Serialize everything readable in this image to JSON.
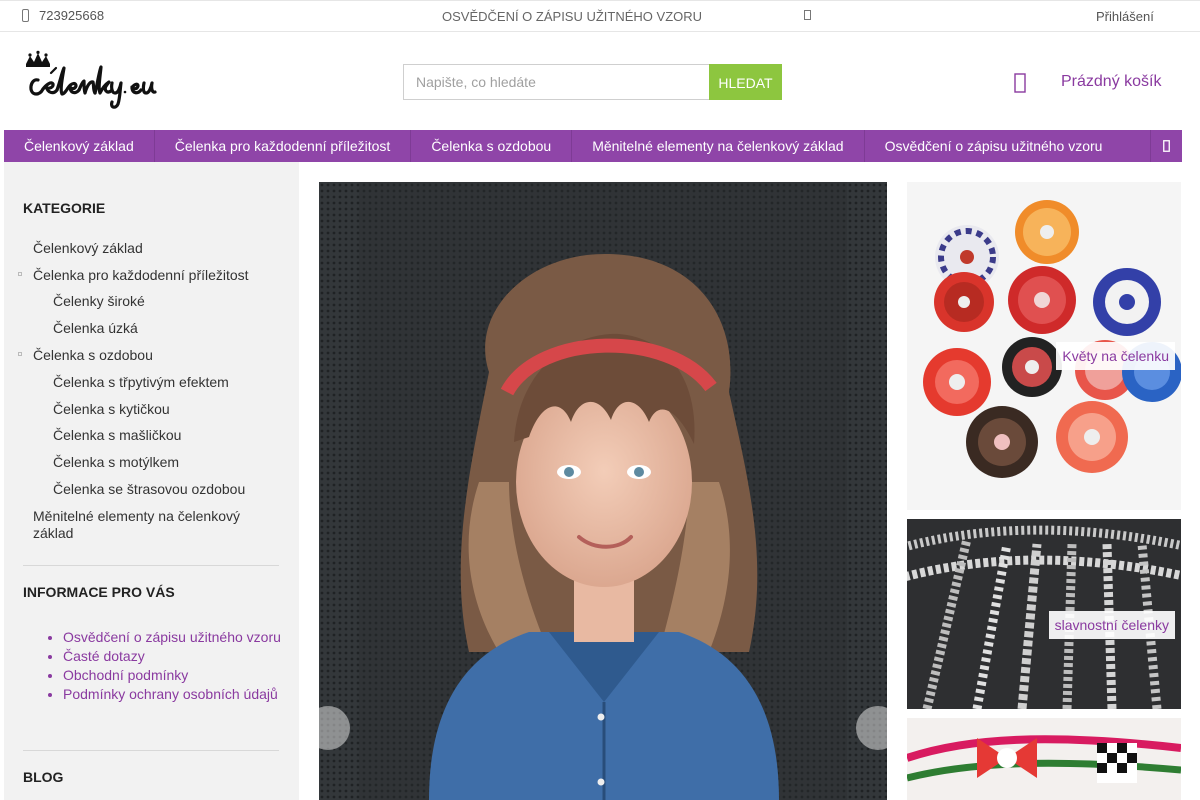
{
  "topbar": {
    "phone": "723925668",
    "promo": "OSVĚDČENÍ O ZÁPISU UŽITNÉHO VZORU",
    "login": "Přihlášení"
  },
  "header": {
    "logo_text": "čelenky.eu",
    "search_placeholder": "Napište, co hledáte",
    "search_button": "HLEDAT",
    "cart_label": "Prázdný košík"
  },
  "nav": {
    "items": [
      "Čelenkový základ",
      "Čelenka pro každodenní příležitost",
      "Čelenka s ozdobou",
      "Měnitelné elementy na čelenkový základ",
      "Osvědčení o zápisu užitného vzoru"
    ]
  },
  "sidebar": {
    "categories_title": "KATEGORIE",
    "categories": [
      "Čelenkový základ",
      "Čelenka pro každodenní příležitost",
      "Čelenky široké",
      "Čelenka úzká",
      "Čelenka s ozdobou",
      "Čelenka s třpytivým efektem",
      "Čelenka s kytičkou",
      "Čelenka s mašličkou",
      "Čelenka s motýlkem",
      "Čelenka se štrasovou ozdobou",
      "Měnitelné elementy na čelenkový základ"
    ],
    "info_title": "INFORMACE PRO VÁS",
    "info_links": [
      "Osvědčení o zápisu užitného vzoru",
      "Časté dotazy",
      "Obchodní podmínky",
      "Podmínky ochrany osobních údajů"
    ],
    "blog_title": "BLOG"
  },
  "banners": {
    "flowers": "Květy na čelenku",
    "festive": "slavnostní čelenky"
  },
  "colors": {
    "brand": "#8f45a8",
    "link": "#8a3aa0",
    "search_button": "#8dc63f"
  }
}
